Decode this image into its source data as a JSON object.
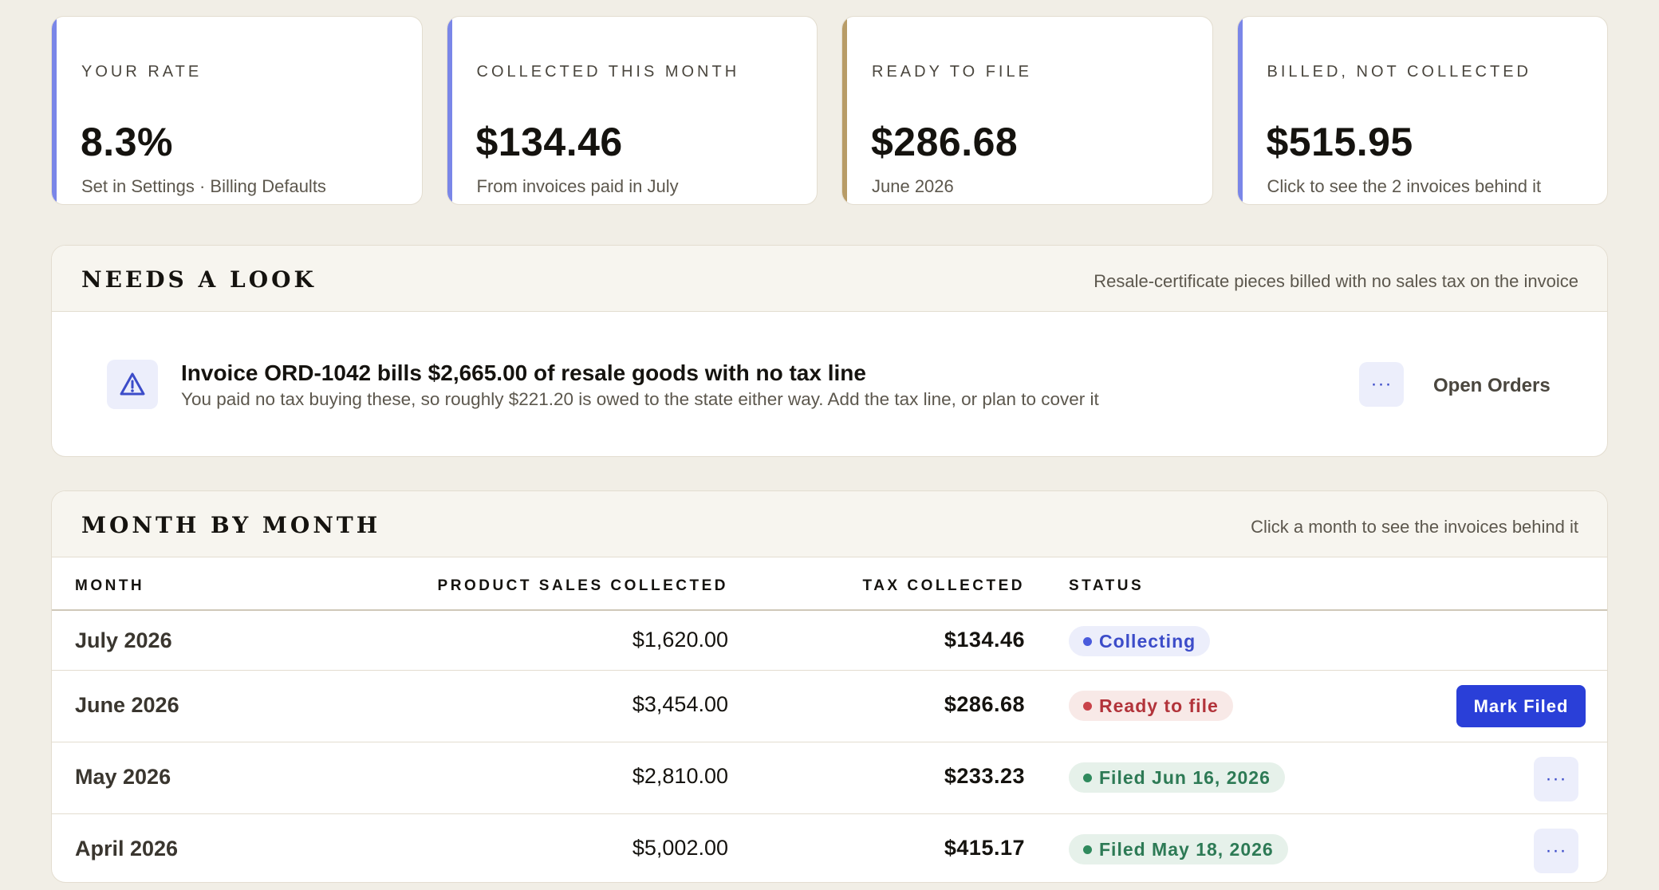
{
  "cards": [
    {
      "label": "YOUR RATE",
      "value": "8.3%",
      "sub": "Set in Settings · Billing Defaults",
      "accent": "#7a86e8"
    },
    {
      "label": "COLLECTED THIS MONTH",
      "value": "$134.46",
      "sub": "From invoices paid in July",
      "accent": "#7a86e8"
    },
    {
      "label": "READY TO FILE",
      "value": "$286.68",
      "sub": "June 2026",
      "accent": "#b89c67"
    },
    {
      "label": "BILLED, NOT COLLECTED",
      "value": "$515.95",
      "sub": "Click to see the 2 invoices behind it",
      "accent": "#7a86e8"
    }
  ],
  "needs_look": {
    "title": "NEEDS A LOOK",
    "note": "Resale-certificate pieces billed with no sales tax on the invoice",
    "alert": {
      "icon": "warning-triangle-icon",
      "title": "Invoice ORD-1042 bills $2,665.00 of resale goods with no tax line",
      "text": "You paid no tax buying these, so roughly $221.20 is owed to the state either way. Add the tax line, or plan to cover it",
      "more_label": "···",
      "action_label": "Open Orders"
    }
  },
  "months": {
    "title": "MONTH BY MONTH",
    "note": "Click a month to see the invoices behind it",
    "columns": {
      "month": "MONTH",
      "sales": "PRODUCT SALES COLLECTED",
      "tax": "TAX COLLECTED",
      "status": "STATUS"
    },
    "rows": [
      {
        "month": "July 2026",
        "sales": "$1,620.00",
        "tax": "$134.46",
        "status": "Collecting",
        "status_color": "#3c4cc9",
        "status_bg": "#eceefb",
        "dot": "#4a5bdc",
        "action": "",
        "more": ""
      },
      {
        "month": "June 2026",
        "sales": "$3,454.00",
        "tax": "$286.68",
        "status": "Ready to file",
        "status_color": "#b2333a",
        "status_bg": "#f8e9e7",
        "dot": "#c9434a",
        "action": "Mark Filed",
        "more": ""
      },
      {
        "month": "May 2026",
        "sales": "$2,810.00",
        "tax": "$233.23",
        "status": "Filed Jun 16, 2026",
        "status_color": "#2d7a55",
        "status_bg": "#e6f1ea",
        "dot": "#2f8a5d",
        "action": "",
        "more": "···"
      },
      {
        "month": "April 2026",
        "sales": "$5,002.00",
        "tax": "$415.17",
        "status": "Filed May 18, 2026",
        "status_color": "#2d7a55",
        "status_bg": "#e6f1ea",
        "dot": "#2f8a5d",
        "action": "",
        "more": "···"
      }
    ]
  }
}
